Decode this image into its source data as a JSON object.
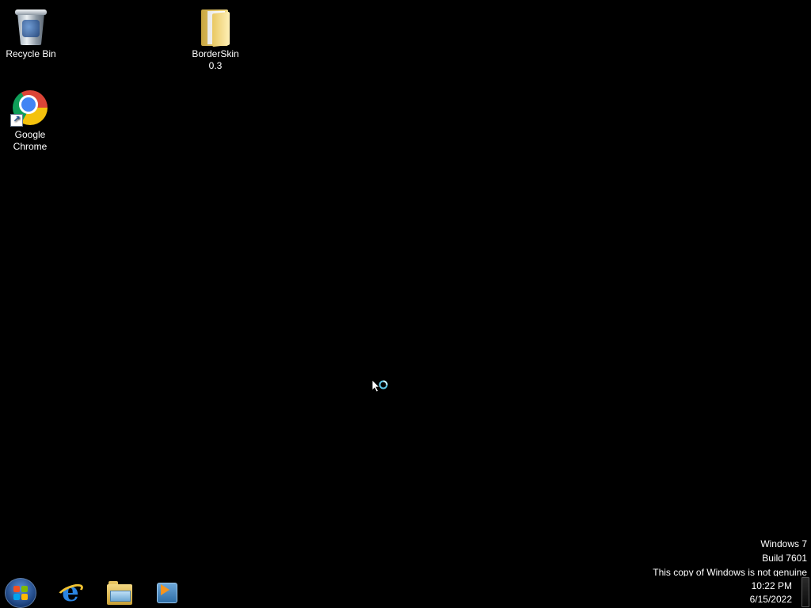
{
  "desktop": {
    "background_color": "#000000",
    "icons": [
      {
        "name": "recycle-bin",
        "label": "Recycle Bin",
        "icon": "recycle-bin-icon"
      },
      {
        "name": "borderskin-folder",
        "label": "BorderSkin\n0.3",
        "icon": "folder-icon"
      },
      {
        "name": "google-chrome-shortcut",
        "label": "Google\nChrome",
        "icon": "chrome-icon",
        "shortcut": true
      }
    ]
  },
  "cursor": {
    "state": "busy",
    "icon": "busy-cursor-icon"
  },
  "taskbar": {
    "start_button": {
      "icon": "windows-start-orb-icon"
    },
    "pinned": [
      {
        "name": "internet-explorer",
        "icon": "internet-explorer-icon"
      },
      {
        "name": "windows-explorer",
        "icon": "windows-explorer-icon"
      },
      {
        "name": "windows-media-player",
        "icon": "media-player-icon"
      }
    ]
  },
  "watermark": {
    "line1": "Windows 7",
    "line2": "Build 7601",
    "line3": "This copy of Windows is not genuine"
  },
  "clock": {
    "time": "10:22 PM",
    "date": "6/15/2022"
  },
  "colors": {
    "text": "#ffffff",
    "ie_blue": "#2b84e0",
    "wmp_orange": "#f7941d"
  }
}
